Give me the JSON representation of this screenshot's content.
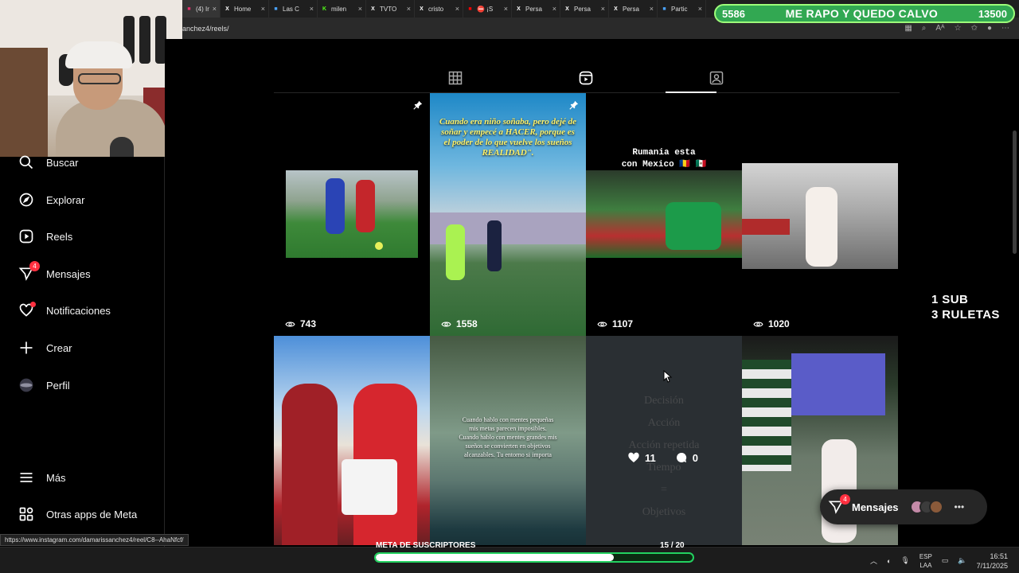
{
  "browser": {
    "tabs": [
      {
        "label": "(4) In",
        "icon": "instagram-icon",
        "color": "#e1306c"
      },
      {
        "label": "Home",
        "icon": "x-icon",
        "color": "#ffffff"
      },
      {
        "label": "Las C",
        "icon": "site-icon",
        "color": "#4aa3ff"
      },
      {
        "label": "milen",
        "icon": "k-icon",
        "color": "#53fc18"
      },
      {
        "label": "TVTO",
        "icon": "x-icon",
        "color": "#ffffff"
      },
      {
        "label": "cristo",
        "icon": "x-icon",
        "color": "#ffffff"
      },
      {
        "label": "⛔ ¡S",
        "icon": "youtube-icon",
        "color": "#ff0000"
      },
      {
        "label": "Persa",
        "icon": "x-icon",
        "color": "#ffffff"
      },
      {
        "label": "Persa",
        "icon": "x-icon",
        "color": "#ffffff"
      },
      {
        "label": "Persa",
        "icon": "x-icon",
        "color": "#ffffff"
      },
      {
        "label": "Partic",
        "icon": "site-icon",
        "color": "#4aa3ff"
      }
    ],
    "url": "anchez4/reels/",
    "status_url": "https://www.instagram.com/damarissanchez4/reel/C8--AhaNfcf/"
  },
  "stream_overlay": {
    "goal_left": "5586",
    "goal_title": "ME RAPO Y QUEDO CALVO",
    "goal_right": "13500",
    "sub_note_line1": "1 SUB",
    "sub_note_line2": "3 RULETAS",
    "bottom_goal_label": "META DE SUSCRIPTORES",
    "bottom_goal_value": "15 / 20",
    "bottom_goal_progress": 0.75
  },
  "sidebar": {
    "items": [
      {
        "label": "Buscar",
        "icon": "search-icon"
      },
      {
        "label": "Explorar",
        "icon": "compass-icon"
      },
      {
        "label": "Reels",
        "icon": "reels-icon"
      },
      {
        "label": "Mensajes",
        "icon": "messenger-icon",
        "badge": "4"
      },
      {
        "label": "Notificaciones",
        "icon": "heart-icon"
      },
      {
        "label": "Crear",
        "icon": "plus-icon"
      },
      {
        "label": "Perfil",
        "icon": "avatar-icon"
      }
    ],
    "more_label": "Más",
    "meta_label": "Otras apps de Meta"
  },
  "profile_tabs": [
    "grid-icon",
    "reels-icon",
    "tagged-icon"
  ],
  "reels": [
    {
      "views": "743",
      "pinned": true,
      "caption": ""
    },
    {
      "views": "1558",
      "pinned": true,
      "caption": "Cuando era niño soñaba, pero dejé de soñar y empecé a HACER, porque es el poder de lo que vuelve los sueños REALIDAD\"."
    },
    {
      "views": "1107",
      "pinned": false,
      "caption_line1": "Rumania esta",
      "caption_line2": "con Mexico 🇷🇴 🇲🇽"
    },
    {
      "views": "1020",
      "pinned": false,
      "caption": ""
    },
    {
      "views": "",
      "caption": ""
    },
    {
      "views": "",
      "caption": "Cuando hablo con mentes pequeñas mis metas parecen imposibles. Cuando hablo con mentes grandes mis sueños se convierten en objetivos alcanzables. Tu entorno si importa"
    },
    {
      "views": "",
      "likes": "11",
      "comments": "0",
      "words": [
        "Decisión",
        "Acción",
        "Acción repetida",
        "Tiempo",
        "=",
        "Objetivos"
      ]
    },
    {
      "views": "",
      "caption": ""
    }
  ],
  "messages_pill": {
    "label": "Mensajes",
    "badge": "4"
  },
  "taskbar": {
    "lang_top": "ESP",
    "lang_bottom": "LAA",
    "time": "16:51",
    "date": "7/11/2025"
  },
  "colors": {
    "accent_green": "#32a852",
    "badge_red": "#ff3040"
  }
}
